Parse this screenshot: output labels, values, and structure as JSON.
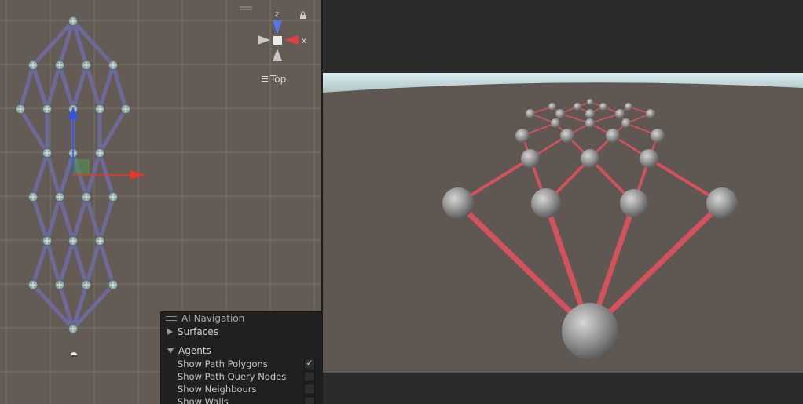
{
  "scene_view": {
    "view_label": "Top",
    "gizmo": {
      "z_axis_label": "z",
      "x_axis_label": "x"
    },
    "colors": {
      "background": "#645c54",
      "grid": "#7a736b",
      "graph_edge": "#6f6ba8",
      "graph_node": "#8fa4a4",
      "move_x": "#e23a2a",
      "move_y": "#2f55f0",
      "move_plane": "#4f8f5a"
    }
  },
  "ai_navigation_panel": {
    "title": "AI Navigation",
    "sections": [
      {
        "label": "Surfaces",
        "expanded": false
      },
      {
        "label": "Agents",
        "expanded": true
      }
    ],
    "options": [
      {
        "label": "Show Path Polygons",
        "checked": true
      },
      {
        "label": "Show Path Query Nodes",
        "checked": false
      },
      {
        "label": "Show Neighbours",
        "checked": false
      },
      {
        "label": "Show Walls",
        "checked": false
      }
    ]
  },
  "game_view": {
    "colors": {
      "ground": "#5f5751",
      "sky": "#cde6ea",
      "edge": "#d4525c",
      "sphere": "#9a9a9a"
    }
  }
}
